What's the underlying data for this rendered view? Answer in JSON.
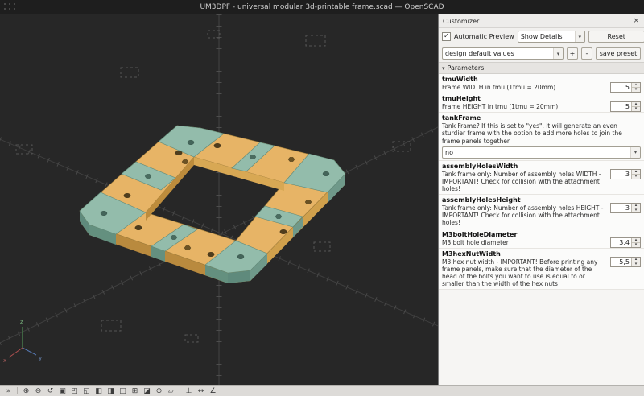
{
  "window": {
    "title": "UM3DPF - universal modular 3d-printable frame.scad — OpenSCAD"
  },
  "icons": {
    "close": "×",
    "check": "✓",
    "dropdown": "▾",
    "collapse": "▾",
    "spin_up": "▴",
    "spin_down": "▾"
  },
  "customizer": {
    "title": "Customizer",
    "automatic_preview": "Automatic Preview",
    "show_details": "Show Details",
    "reset": "Reset",
    "preset_select": "design default values",
    "add_preset": "+",
    "remove_preset": "-",
    "save_preset": "save preset",
    "parameters_header": "Parameters",
    "parameters": [
      {
        "name": "tmuWidth",
        "description": "Frame WIDTH in tmu (1tmu = 20mm)",
        "value": "5",
        "control": "spin"
      },
      {
        "name": "tmuHeight",
        "description": "Frame HEIGHT in tmu (1tmu = 20mm)",
        "value": "5",
        "control": "spin"
      },
      {
        "name": "tankFrame",
        "description": "Tank Frame? If this is set to \"yes\", it will generate an even sturdier frame with the option to add more holes to join the frame panels together.",
        "value": "no",
        "control": "select"
      },
      {
        "name": "assemblyHolesWidth",
        "description": "Tank frame only: Number of assembly holes WIDTH - IMPORTANT! Check for collision with the attachment holes!",
        "value": "3",
        "control": "spin"
      },
      {
        "name": "assemblyHolesHeight",
        "description": "Tank frame only: Number of assembly holes HEIGHT - IMPORTANT! Check for collision with the attachment holes!",
        "value": "3",
        "control": "spin"
      },
      {
        "name": "M3boltHoleDiameter",
        "description": "M3 bolt hole diameter",
        "value": "3,4",
        "control": "spin"
      },
      {
        "name": "M3hexNutWidth",
        "description": "M3 hex nut width - IMPORTANT! Before printing any frame panels, make sure that the diameter of the head of the bolts you want to use is equal to or smaller than the width of the hex nuts!",
        "value": "5,5",
        "control": "spin"
      }
    ]
  },
  "viewport": {
    "axes": {
      "x": "x",
      "y": "y",
      "z": "z"
    },
    "model_colors": {
      "frame_top": "#e7b466",
      "frame_side": "#c3913f",
      "corner_teal": "#93bcab",
      "corner_teal_side": "#6f998a"
    }
  },
  "view_toolbar": {
    "items": [
      {
        "name": "expand-toolbar",
        "glyph": "»"
      },
      {
        "name": "zoom-in",
        "glyph": "⊕"
      },
      {
        "name": "zoom-out",
        "glyph": "⊖"
      },
      {
        "name": "reset-view",
        "glyph": "↺"
      },
      {
        "name": "view-all",
        "glyph": "▣"
      },
      {
        "name": "top-view",
        "glyph": "◰"
      },
      {
        "name": "bottom-view",
        "glyph": "◱"
      },
      {
        "name": "left-view",
        "glyph": "◧"
      },
      {
        "name": "right-view",
        "glyph": "◨"
      },
      {
        "name": "front-view",
        "glyph": "□"
      },
      {
        "name": "back-view",
        "glyph": "⊞"
      },
      {
        "name": "diagonal-view",
        "glyph": "◪"
      },
      {
        "name": "center-view",
        "glyph": "⊙"
      },
      {
        "name": "perspective-view",
        "glyph": "▱"
      },
      {
        "name": "orthogonal-view",
        "glyph": "⊥"
      },
      {
        "name": "measure-distance",
        "glyph": "↔"
      },
      {
        "name": "measure-angle",
        "glyph": "∠"
      }
    ]
  }
}
